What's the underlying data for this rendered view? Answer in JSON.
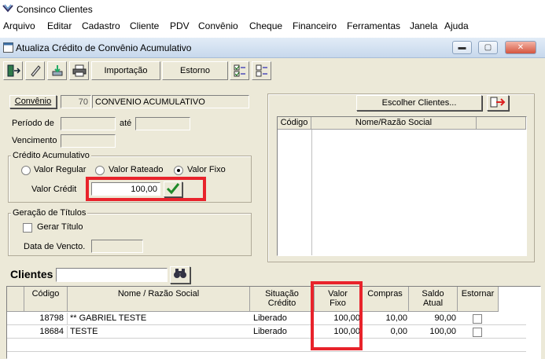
{
  "app": {
    "title": "Consinco Clientes"
  },
  "menu": [
    "Arquivo",
    "Editar",
    "Cadastro",
    "Cliente",
    "PDV",
    "Convênio",
    "Cheque",
    "Financeiro",
    "Ferramentas",
    "Janela",
    "Ajuda"
  ],
  "window": {
    "title": "Atualiza Crédito de Convênio Acumulativo"
  },
  "toolbar": {
    "importacao": "Importação",
    "estorno": "Estorno"
  },
  "form": {
    "convenio_btn": "Convênio",
    "convenio_code": "70",
    "convenio_name": "CONVENIO ACUMULATIVO",
    "periodo_label": "Período de",
    "ate_label": "até",
    "vencimento_label": "Vencimento",
    "credito_group": "Crédito Acumulativo",
    "radio_regular": "Valor Regular",
    "radio_rateado": "Valor Rateado",
    "radio_fixo": "Valor Fixo",
    "valor_credito_label": "Valor Crédit",
    "valor_credito": "100,00",
    "geracao_group": "Geração de Títulos",
    "gerar_titulo": "Gerar Título",
    "data_vencto_label": "Data de Vencto."
  },
  "right_panel": {
    "choose_btn": "Escolher Clientes...",
    "col_codigo": "Código",
    "col_nome": "Nome/Razão Social"
  },
  "clients": {
    "label": "Clientes",
    "columns": [
      "Código",
      "Nome / Razão Social",
      "Situação Crédito",
      "Valor Fixo",
      "Compras",
      "Saldo Atual",
      "Estornar"
    ],
    "col_situacao_1": "Situação",
    "col_situacao_2": "Crédito",
    "col_valor_1": "Valor",
    "col_valor_2": "Fixo",
    "col_saldo_1": "Saldo",
    "col_saldo_2": "Atual",
    "rows": [
      {
        "codigo": "18798",
        "nome": "** GABRIEL TESTE",
        "situacao": "Liberado",
        "valor": "100,00",
        "compras": "10,00",
        "saldo": "90,00"
      },
      {
        "codigo": "18684",
        "nome": "TESTE",
        "situacao": "Liberado",
        "valor": "100,00",
        "compras": "0,00",
        "saldo": "100,00"
      }
    ]
  },
  "colors": {
    "highlight": "#e8232b",
    "window_bg": "#ece9d8",
    "title_bar": "#c7d8ec"
  }
}
